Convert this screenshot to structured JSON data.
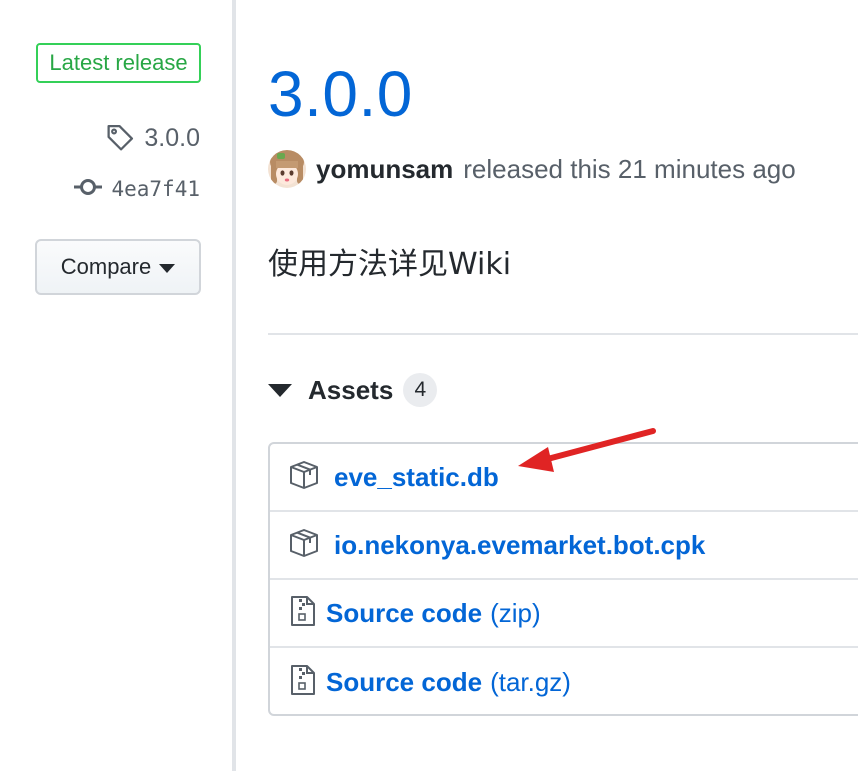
{
  "sidebar": {
    "latest_label": "Latest release",
    "tag": "3.0.0",
    "commit": "4ea7f41",
    "compare_label": "Compare"
  },
  "release": {
    "title": "3.0.0",
    "author": "yomunsam",
    "released_text": "released this 21 minutes ago",
    "description": "使用方法详见Wiki"
  },
  "assets": {
    "label": "Assets",
    "count": "4",
    "items": [
      {
        "name": "eve_static.db",
        "suffix": "",
        "icon": "package-icon"
      },
      {
        "name": "io.nekonya.evemarket.bot.cpk",
        "suffix": "",
        "icon": "package-icon"
      },
      {
        "name": "Source code",
        "suffix": "(zip)",
        "icon": "file-zip-icon"
      },
      {
        "name": "Source code",
        "suffix": "(tar.gz)",
        "icon": "file-zip-icon"
      }
    ]
  },
  "colors": {
    "link": "#0366d6",
    "latest_green": "#28a745",
    "annotation_arrow": "#e02424"
  }
}
